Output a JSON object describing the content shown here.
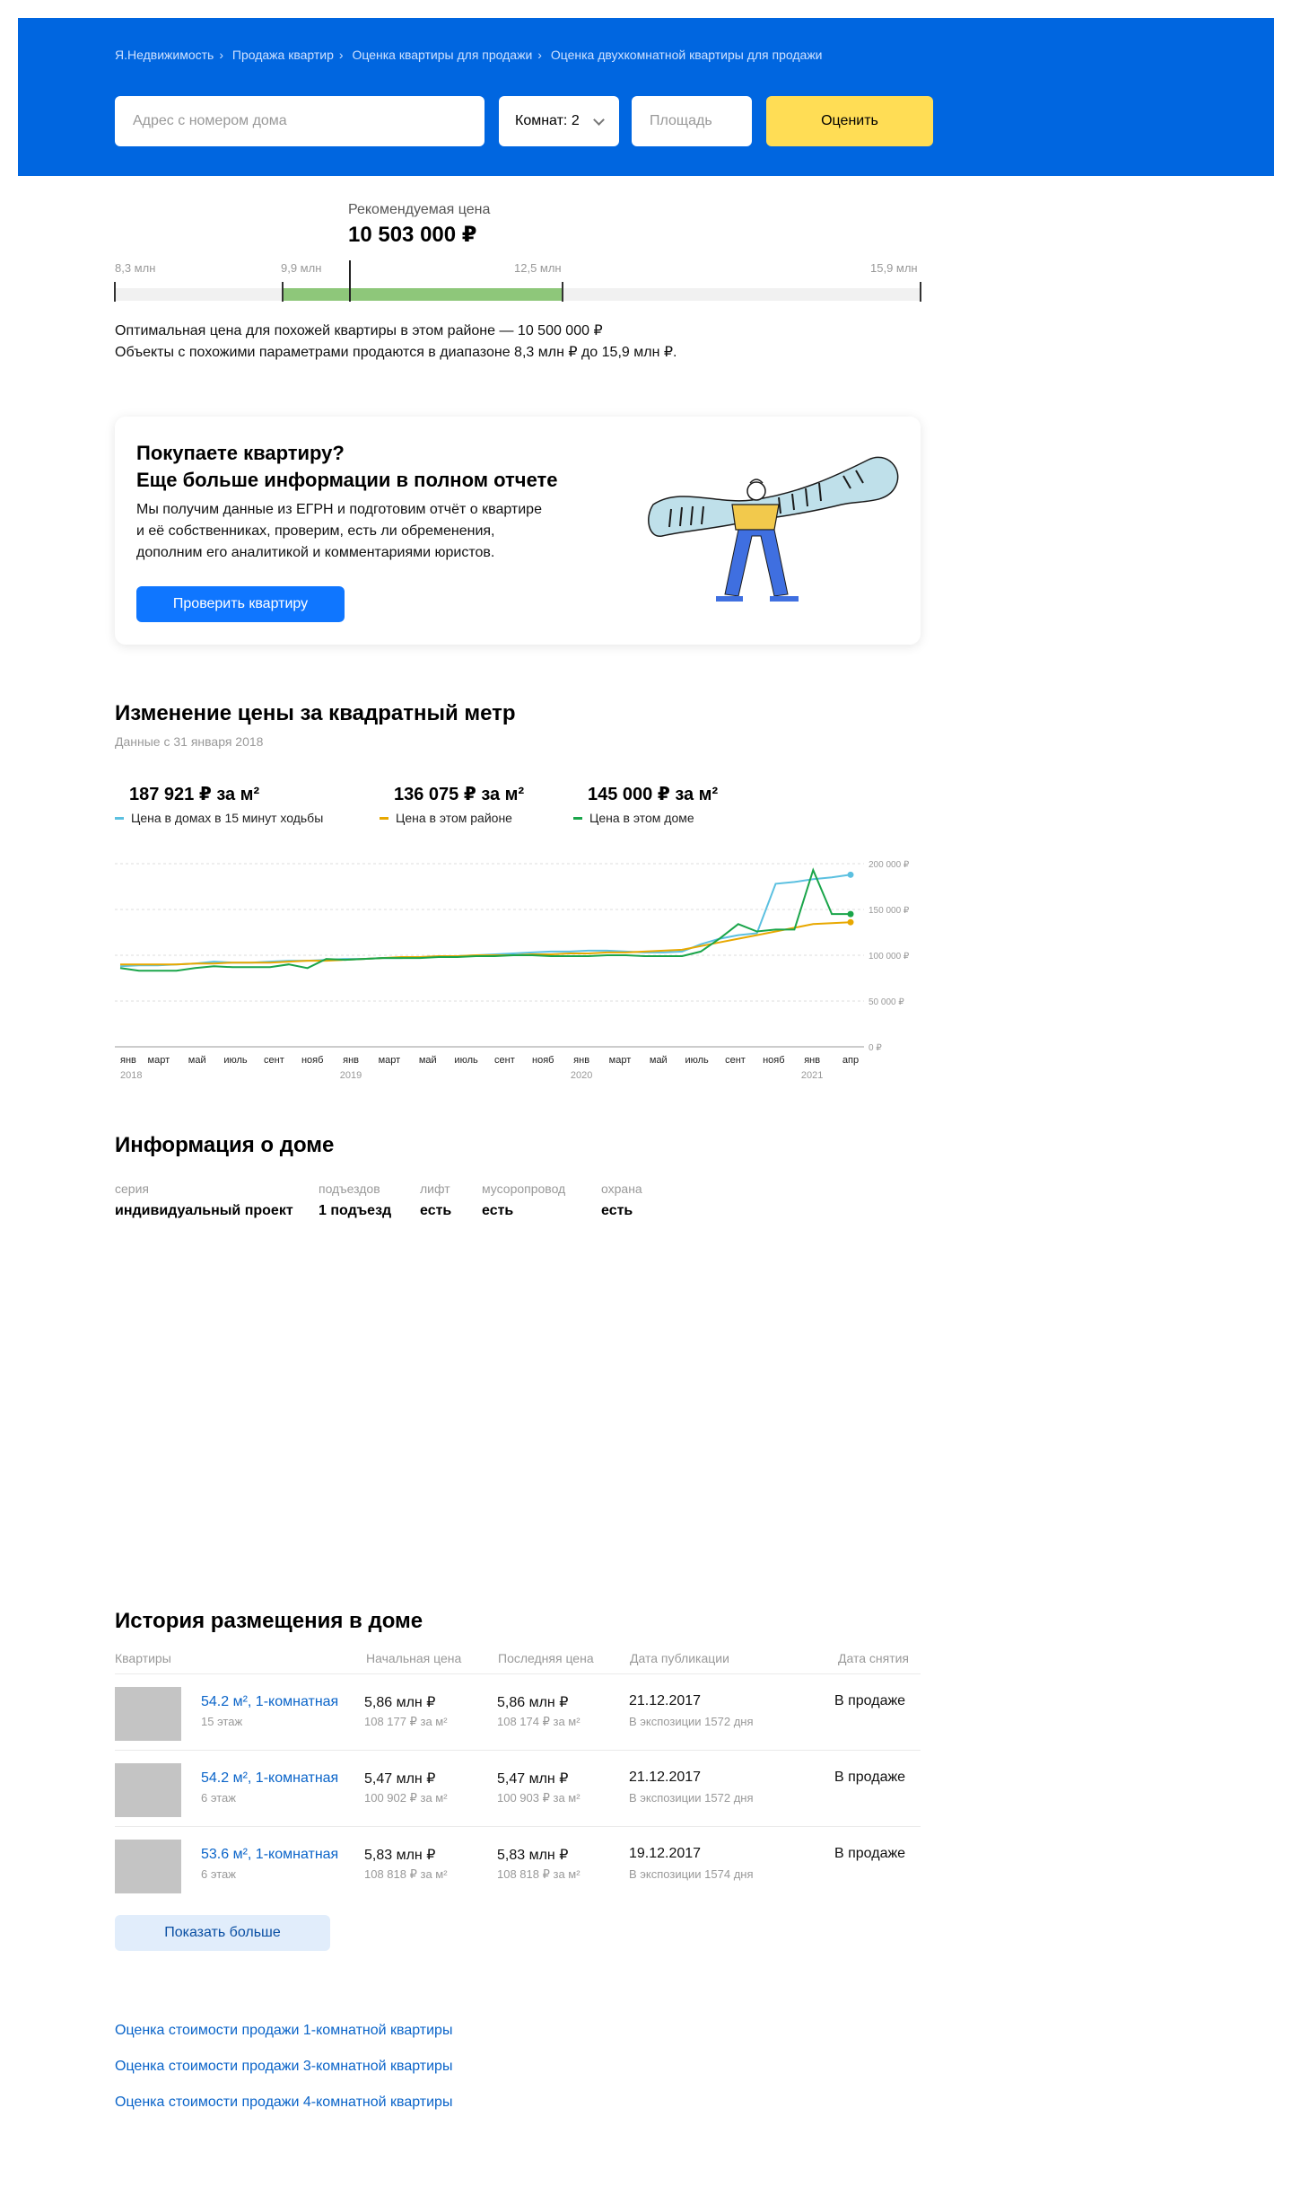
{
  "breadcrumbs": [
    "Я.Недвижимость",
    "Продажа квартир",
    "Оценка квартиры для продажи",
    "Оценка двухкомнатной квартиры для продажи"
  ],
  "search": {
    "address_placeholder": "Адрес с номером дома",
    "rooms_value": "Комнат: 2",
    "area_placeholder": "Площадь",
    "submit_label": "Оценить"
  },
  "estimate": {
    "label": "Рекомендуемая цена",
    "price": "10 503 000 ₽",
    "scale_min": "8,3 млн",
    "range_low": "9,9 млн",
    "range_high": "12,5 млн",
    "scale_max": "15,9 млн",
    "line1": "Оптимальная цена для похожей квартиры в этом районе — 10 500 000 ₽",
    "line2": "Объекты с похожими параметрами продаются в диапазоне 8,3 млн ₽ до 15,9 млн ₽."
  },
  "promo": {
    "title1": "Покупаете квартиру?",
    "title2": "Еще больше информации в полном отчете",
    "text1": "Мы получим данные из ЕГРН и подготовим отчёт о квартире",
    "text2": "и её собственниках, проверим, есть ли обременения,",
    "text3": "дополним его аналитикой и комментариями юристов.",
    "button": "Проверить квартиру"
  },
  "price_change": {
    "title": "Изменение цены за квадратный метр",
    "subtitle": "Данные с 31 января 2018",
    "legend": [
      {
        "value": "187 921 ₽ за м²",
        "name": "Цена в домах в 15 минут ходьбы",
        "color": "#5bc0e0"
      },
      {
        "value": "136 075 ₽ за м²",
        "name": "Цена в этом районе",
        "color": "#e8a800"
      },
      {
        "value": "145 000 ₽ за м²",
        "name": "Цена в этом доме",
        "color": "#1aa54a"
      }
    ]
  },
  "chart_data": {
    "type": "line",
    "y_ticks": [
      "200 000 ₽",
      "150 000 ₽",
      "100 000 ₽",
      "50 000 ₽",
      "0 ₽"
    ],
    "ylim": [
      0,
      200000
    ],
    "x_ticks": [
      "янв",
      "март",
      "май",
      "июль",
      "сент",
      "нояб",
      "янв",
      "март",
      "май",
      "июль",
      "сент",
      "нояб",
      "янв",
      "март",
      "май",
      "июль",
      "сент",
      "нояб",
      "янв",
      "апр"
    ],
    "year_labels": [
      {
        "label": "2018",
        "tick": 0
      },
      {
        "label": "2019",
        "tick": 6
      },
      {
        "label": "2020",
        "tick": 12
      },
      {
        "label": "2021",
        "tick": 18
      }
    ],
    "x_count": 40,
    "series": [
      {
        "name": "Цена в домах в 15 минут ходьбы",
        "color": "#5bc0e0",
        "values": [
          88000,
          89000,
          89000,
          90000,
          91000,
          93000,
          92000,
          92000,
          93000,
          94000,
          94000,
          95000,
          96000,
          96000,
          97000,
          97000,
          98000,
          98000,
          99000,
          100000,
          101000,
          102000,
          103000,
          104000,
          104000,
          105000,
          105000,
          104000,
          103000,
          103000,
          104000,
          112000,
          118000,
          122000,
          124000,
          178000,
          180000,
          183000,
          185000,
          187921
        ]
      },
      {
        "name": "Цена в этом районе",
        "color": "#e8a800",
        "values": [
          90000,
          90000,
          90000,
          90000,
          91000,
          91000,
          92000,
          92000,
          92000,
          93000,
          94000,
          94000,
          95000,
          96000,
          97000,
          98000,
          98000,
          99000,
          99000,
          100000,
          100000,
          100000,
          101000,
          101000,
          102000,
          102000,
          103000,
          103000,
          104000,
          105000,
          106000,
          110000,
          114000,
          118000,
          122000,
          126000,
          130000,
          134000,
          135000,
          136075
        ]
      },
      {
        "name": "Цена в этом доме",
        "color": "#1aa54a",
        "values": [
          86000,
          83000,
          83000,
          83000,
          86000,
          88000,
          87000,
          87000,
          87000,
          90000,
          86000,
          96000,
          95000,
          96000,
          97000,
          97000,
          97000,
          98000,
          98000,
          99000,
          99000,
          100000,
          100000,
          99000,
          99000,
          99000,
          100000,
          100000,
          99000,
          99000,
          99000,
          104000,
          118000,
          134000,
          126000,
          128000,
          128000,
          193000,
          145000,
          145000
        ]
      }
    ]
  },
  "house_info": {
    "title": "Информация о доме",
    "fields": [
      {
        "key": "серия",
        "value": "индивидуальный проект"
      },
      {
        "key": "подъездов",
        "value": "1 подъезд"
      },
      {
        "key": "лифт",
        "value": "есть"
      },
      {
        "key": "мусоропровод",
        "value": "есть"
      },
      {
        "key": "охрана",
        "value": "есть"
      }
    ]
  },
  "history": {
    "title": "История размещения в доме",
    "columns": [
      "Квартиры",
      "Начальная цена",
      "Последняя цена",
      "Дата публикации",
      "Дата снятия"
    ],
    "rows": [
      {
        "title": "54.2 м², 1-комнатная",
        "floor": "15 этаж",
        "start": "5,86 млн ₽",
        "start_m2": "108 177 ₽ за м²",
        "last": "5,86 млн ₽",
        "last_m2": "108 174 ₽ за м²",
        "date": "21.12.2017",
        "exposure": "В экспозиции 1572 дня",
        "removed": "В продаже"
      },
      {
        "title": "54.2 м², 1-комнатная",
        "floor": "6 этаж",
        "start": "5,47 млн ₽",
        "start_m2": "100 902 ₽ за м²",
        "last": "5,47 млн ₽",
        "last_m2": "100 903 ₽ за м²",
        "date": "21.12.2017",
        "exposure": "В экспозиции 1572 дня",
        "removed": "В продаже"
      },
      {
        "title": "53.6 м², 1-комнатная",
        "floor": "6 этаж",
        "start": "5,83 млн ₽",
        "start_m2": "108 818 ₽ за м²",
        "last": "5,83 млн ₽",
        "last_m2": "108 818 ₽ за м²",
        "date": "19.12.2017",
        "exposure": "В экспозиции 1574 дня",
        "removed": "В продаже"
      }
    ],
    "more_button": "Показать больше"
  },
  "footer_links": [
    "Оценка стоимости продажи 1-комнатной квартиры",
    "Оценка стоимости продажи 3-комнатной квартиры",
    "Оценка стоимости продажи 4-комнатной квартиры"
  ]
}
